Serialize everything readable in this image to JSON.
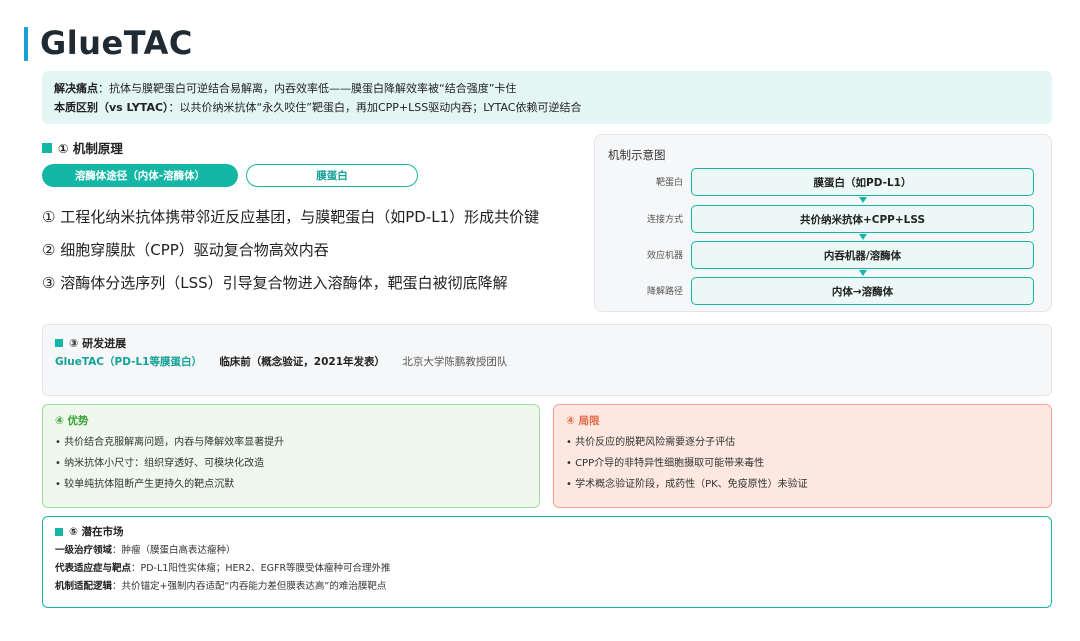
{
  "page": {
    "title": "GlueTAC"
  },
  "summary": {
    "pain_label": "解决痛点",
    "pain_text": "：抗体与膜靶蛋白可逆结合易解离，内吞效率低——膜蛋白降解效率被“结合强度”卡住",
    "diff_label": "本质区别（vs LYTAC）",
    "diff_text": "：以共价纳米抗体“永久咬住”靶蛋白，再加CPP+LSS驱动内吞；LYTAC依赖可逆结合"
  },
  "mechanism": {
    "heading": "① 机制原理",
    "tabs": [
      {
        "label": "溶酶体途径（内体-溶酶体）",
        "active": true
      },
      {
        "label": "膜蛋白",
        "active": false
      }
    ],
    "points": [
      "① 工程化纳米抗体携带邻近反应基团，与膜靶蛋白（如PD-L1）形成共价键",
      "② 细胞穿膜肽（CPP）驱动复合物高效内吞",
      "③ 溶酶体分选序列（LSS）引导复合物进入溶酶体，靶蛋白被彻底降解"
    ]
  },
  "diagram": {
    "title": "机制示意图",
    "rows": [
      {
        "label": "靶蛋白",
        "value": "膜蛋白（如PD-L1）"
      },
      {
        "label": "连接方式",
        "value": "共价纳米抗体+CPP+LSS"
      },
      {
        "label": "效应机器",
        "value": "内吞机器/溶酶体"
      },
      {
        "label": "降解路径",
        "value": "内体→溶酶体"
      }
    ]
  },
  "progress": {
    "heading": "③ 研发进展",
    "name": "GlueTAC（PD-L1等膜蛋白）",
    "stage": "临床前（概念验证，2021年发表）",
    "team": "北京大学陈鹏教授团队"
  },
  "advantages": {
    "heading": "④ 优势",
    "items": [
      "• 共价结合克服解离问题，内吞与降解效率显著提升",
      "• 纳米抗体小尺寸：组织穿透好、可模块化改造",
      "• 较单纯抗体阻断产生更持久的靶点沉默"
    ]
  },
  "limitations": {
    "heading": "④ 局限",
    "items": [
      "• 共价反应的脱靶风险需要逐分子评估",
      "• CPP介导的非特异性细胞摄取可能带来毒性",
      "• 学术概念验证阶段，成药性（PK、免疫原性）未验证"
    ]
  },
  "market": {
    "heading": "⑤ 潜在市场",
    "lines": [
      {
        "label": "一级治疗领域",
        "text": "：肿瘤（膜蛋白高表达瘤种）"
      },
      {
        "label": "代表适应症与靶点",
        "text": "：PD-L1阳性实体瘤；HER2、EGFR等膜受体瘤种可合理外推"
      },
      {
        "label": "机制适配逻辑",
        "text": "：共价锚定+强制内吞适配“内吞能力差但膜表达高”的难治膜靶点"
      }
    ]
  },
  "colors": {
    "accent": "#14b6a6",
    "title_bar": "#1a9fd6",
    "advantage_border": "#9fdc9c",
    "limitation_border": "#f2a58f"
  }
}
